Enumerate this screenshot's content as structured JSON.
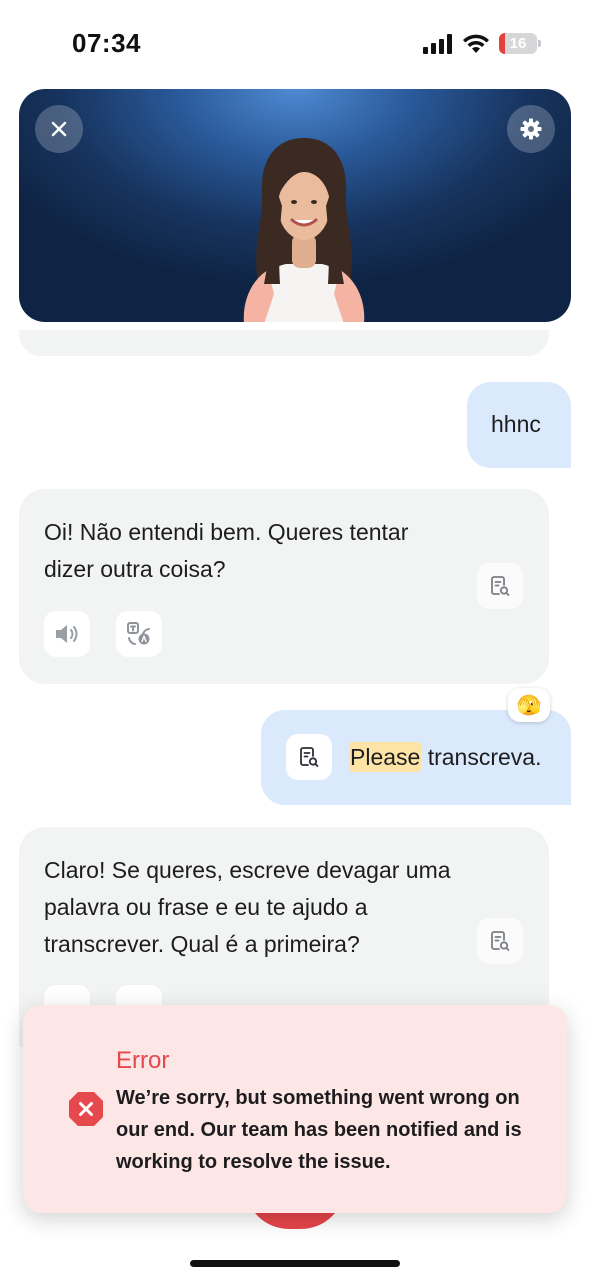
{
  "status_bar": {
    "time": "07:34",
    "battery_level": "16",
    "battery_fraction": 0.16,
    "battery_color": "#e5413c"
  },
  "header": {
    "close_icon": "close-icon",
    "settings_icon": "gear-icon",
    "background_color": "#1a3d6e"
  },
  "chat": {
    "messages": [
      {
        "role": "user",
        "text": "hhnc"
      },
      {
        "role": "assistant",
        "text": "Oi! Não entendi bem. Queres tentar dizer outra coisa?"
      },
      {
        "role": "user",
        "highlight": "Please",
        "text": " transcreva.",
        "reaction": "🫣"
      },
      {
        "role": "assistant",
        "text": "Claro! Se queres, escreve devagar uma palavra ou frase e eu te ajudo a transcrever. Qual é a primeira?"
      }
    ],
    "user_bubble_color": "#dae9fb",
    "assistant_bubble_color": "#f2f3f3",
    "highlight_color": "#fde4a6"
  },
  "toast": {
    "title": "Error",
    "message": "We’re sorry, but something went wrong on our end. Our team has been notified and is working to resolve the issue.",
    "accent_color": "#e5484d",
    "background_color": "#fde6e6"
  }
}
